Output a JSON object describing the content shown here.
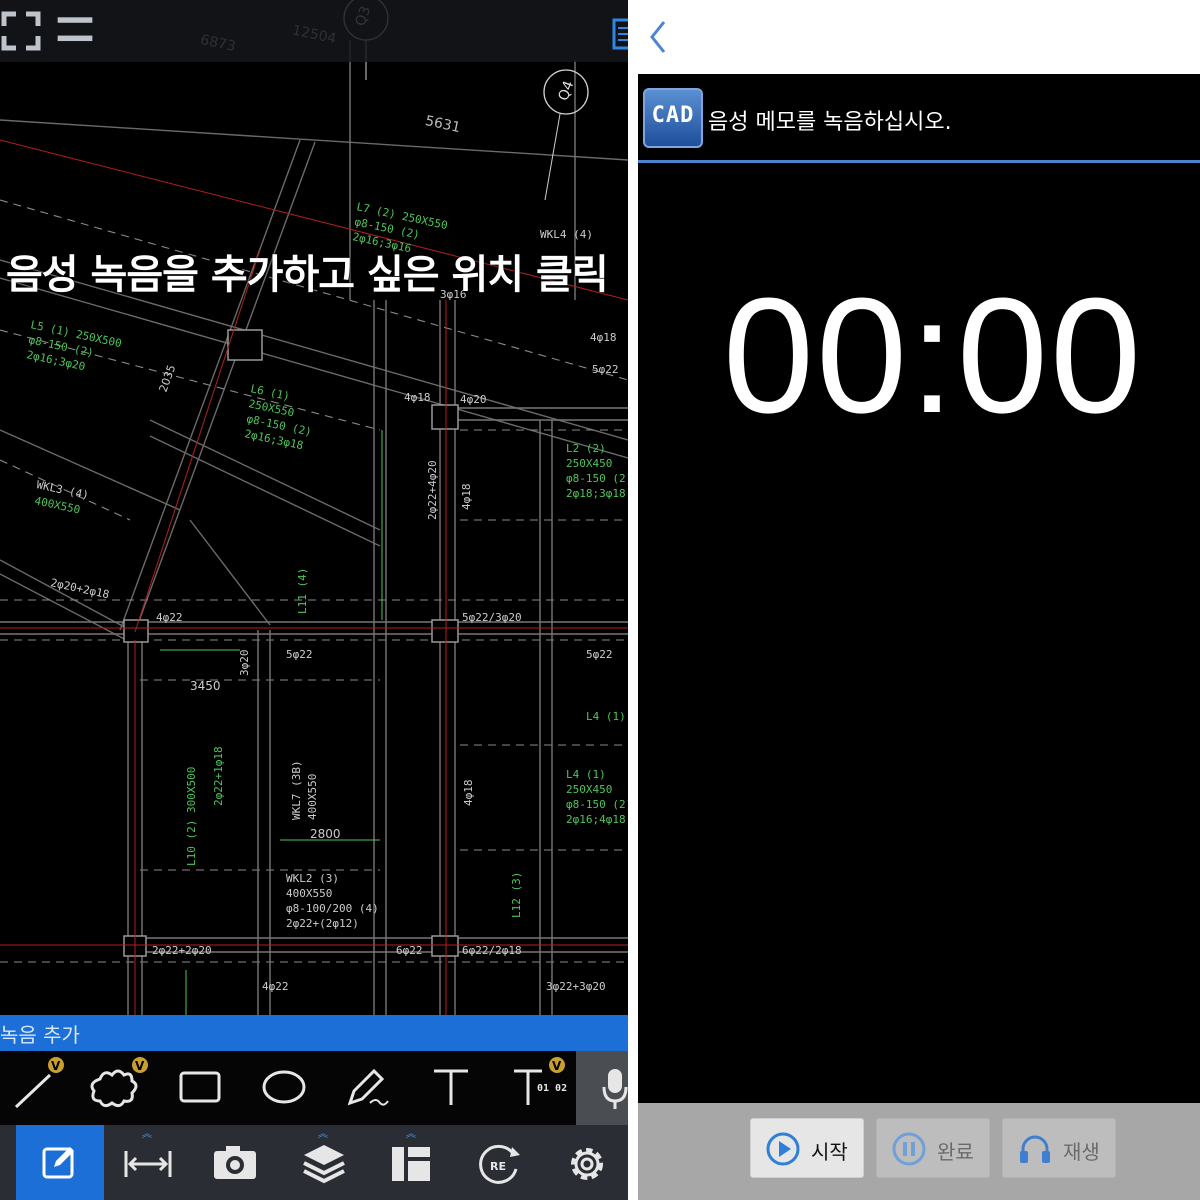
{
  "left": {
    "hint": "음성 녹음을 추가하고 싶은 위치 클릭",
    "mode_label": "녹음 추가",
    "drawing": {
      "grid_labels": [
        "Q3",
        "Q4"
      ],
      "dimensions": [
        "6873",
        "12504",
        "5631",
        "3450",
        "2800",
        "2035"
      ],
      "labels": [
        "WKL4 (4)",
        "WKL3 (4)",
        "400X550",
        "WKL2 (3)",
        "400X550",
        "φ8-100/200 (4)",
        "2φ22+(2φ12)",
        "L2 (2)",
        "250X450",
        "φ8-150 (2)",
        "2φ18;3φ18",
        "L4 (1)",
        "L4 (1)",
        "250X450",
        "φ8-150 (2)",
        "2φ16;4φ18",
        "L5 (1) 250X500",
        "φ8-150 (2)",
        "2φ16;3φ20",
        "L6 (1)",
        "250X550",
        "φ8-150 (2)",
        "2φ16;3φ18",
        "WKL7 (3B)",
        "400X550",
        "L11 (4)",
        "L10 (2) 300X500",
        "L12 (3)",
        "5φ22",
        "5φ22/3φ20",
        "5φ22",
        "4φ18",
        "4φ20",
        "4φ22",
        "4φ18",
        "2φ22+2φ20",
        "6φ22",
        "6φ22/2φ18",
        "3φ22+3φ20",
        "4φ22",
        "3φ20",
        "4φ18",
        "2φ20+2φ18",
        "4φ18",
        "5φ22",
        "L7 (2) 250X550",
        "φ8-150 (2)",
        "2φ16;3φ16",
        "2φ22+1φ18",
        "3φ16",
        "2φ22+4φ20"
      ]
    },
    "tools": [
      "line-tool",
      "cloud-tool",
      "rectangle-tool",
      "ellipse-tool",
      "sketch-tool",
      "text-tool",
      "numbered-text-tool",
      "voice-tool"
    ],
    "nav": [
      "edit",
      "measure",
      "camera",
      "layers",
      "layout",
      "revision",
      "settings"
    ],
    "nav_badge_text": "RE",
    "numbered_text_label": "01 02",
    "accent": "#1b6fd6"
  },
  "right": {
    "title": "음성 메모를 녹음하십시오.",
    "logo_text": "CAD",
    "timer": "00:00",
    "buttons": {
      "start": "시작",
      "done": "완료",
      "play": "재생"
    },
    "accent": "#4d84d0"
  }
}
